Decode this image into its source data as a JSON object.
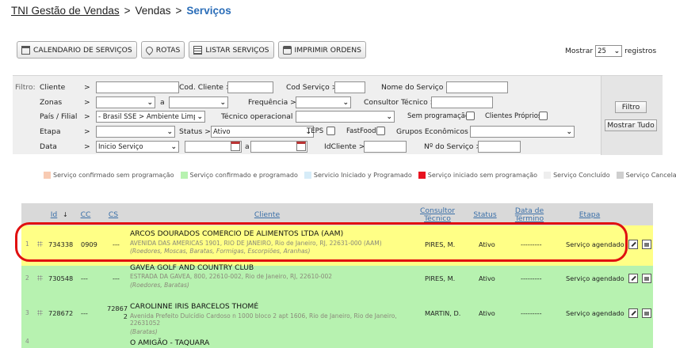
{
  "breadcrumb": {
    "root": "TNI Gestão de Vendas",
    "sep": ">",
    "mid": "Vendas",
    "current": "Serviços"
  },
  "toolbar": {
    "calendar_label": "CALENDARIO DE SERVIÇOS",
    "routes_label": "ROTAS",
    "list_label": "LISTAR SERVIÇOS",
    "print_label": "IMPRIMIR ORDENS"
  },
  "pagination": {
    "show_label": "Mostrar",
    "per_page": "25",
    "records_label": "registros"
  },
  "filters": {
    "title": "Filtro:",
    "cliente_label": "Cliente",
    "codcliente_label": "Cod. Cliente >",
    "codservico_label": "Cod Serviço >",
    "nomeservico_label": "Nome do Serviço >",
    "zonas_label": "Zonas",
    "a_label": "a",
    "frequencia_label": "Frequência >",
    "consultor_label": "Consultor Técnico >",
    "pais_label": "País / Filial",
    "pais_value": "- Brasil SSE > Ambiente Limp...",
    "tecnico_label": "Técnico operacional >",
    "semprog_label": "Sem programação",
    "clientesproprios_label": "Clientes Próprios",
    "etapa_label": "Etapa",
    "status_label": "Status >",
    "status_value": "Ativo",
    "teps_label": "TEPS",
    "fastfood_label": "FastFood",
    "grupos_label": "Grupos Econômicos >",
    "data_label": "Data",
    "data_value": "Inicio Serviço",
    "idcliente_label": "IdCliente >",
    "nservico_label": "Nº do Serviço >",
    "arrow": ">",
    "filter_button": "Filtro",
    "showall_button": "Mostrar Tudo"
  },
  "legend": [
    {
      "label": "Serviço confirmado sem programação",
      "color": "#f8cbb3"
    },
    {
      "label": "Serviço confirmado e programado",
      "color": "#b7f2b0"
    },
    {
      "label": "Servicio Iniciado y Programado",
      "color": "#d6ecf8"
    },
    {
      "label": "Serviço iniciado sem programação",
      "color": "#e8121f"
    },
    {
      "label": "Serviço Concluído",
      "color": "#eeeeee"
    },
    {
      "label": "Serviço Cancelado",
      "color": "#cfcfcf"
    }
  ],
  "grid": {
    "headers": {
      "id": "Id",
      "cc": "CC",
      "cs": "CS",
      "cliente": "Cliente",
      "consultor": "Consultor Técnico",
      "status": "Status",
      "datatermino": "Data de Término",
      "etapa": "Etapa"
    },
    "rows": [
      {
        "n": "1",
        "id": "734338",
        "cc": "0909",
        "cs": "---",
        "cliente": "ARCOS DOURADOS COMERCIO DE ALIMENTOS LTDA (AAM)",
        "addr": "AVENIDA DAS AMERICAS 1901, RIO DE JANEIRO, Rio de Janeiro, RJ, 22631-000 (AAM)",
        "tags": "(Roedores, Moscas, Baratas, Formigas, Escorpiões, Aranhas)",
        "consultor": "PIRES, M.",
        "status": "Ativo",
        "term": "---------",
        "etapa": "Serviço agendado",
        "bg": "#ffff86"
      },
      {
        "n": "2",
        "id": "730548",
        "cc": "---",
        "cs": "---",
        "cliente": "GAVEA GOLF AND COUNTRY CLUB",
        "addr": "ESTRADA DA GAVEA, 800, 22610-002, Rio de Janeiro, RJ, 22610-002",
        "tags": "(Roedores, Baratas)",
        "consultor": "PIRES, M.",
        "status": "Ativo",
        "term": "---------",
        "etapa": "Serviço agendado",
        "bg": "#b7f2b0"
      },
      {
        "n": "3",
        "id": "728672",
        "cc": "---",
        "cs": "72867 2",
        "cliente": "CAROLINNE IRIS BARCELOS THOMÉ",
        "addr": "Avenida Prefeito Dulcídio Cardoso n 1000 bloco 2 apt 1606, Rio de Janeiro, Rio de Janeiro, 22631052",
        "tags": "(Baratas)",
        "consultor": "MARTIN, D.",
        "status": "Ativo",
        "term": "---------",
        "etapa": "Serviço agendado",
        "bg": "#b7f2b0"
      },
      {
        "n": "4",
        "id": "",
        "cc": "",
        "cs": "",
        "cliente": "O AMIGÃO - TAQUARA",
        "addr": "",
        "tags": "",
        "consultor": "",
        "status": "",
        "term": "",
        "etapa": "",
        "bg": "#b7f2b0"
      }
    ]
  }
}
